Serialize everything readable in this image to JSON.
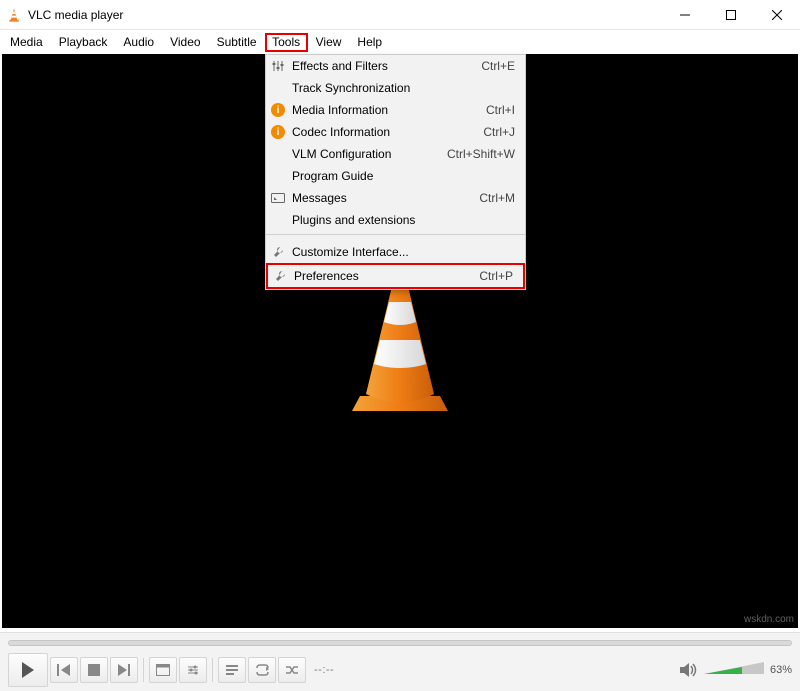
{
  "window": {
    "title": "VLC media player"
  },
  "menubar": {
    "items": [
      "Media",
      "Playback",
      "Audio",
      "Video",
      "Subtitle",
      "Tools",
      "View",
      "Help"
    ],
    "selectedIndex": 5
  },
  "toolsMenu": {
    "items": [
      {
        "icon": "sliders",
        "label": "Effects and Filters",
        "shortcut": "Ctrl+E"
      },
      {
        "icon": "",
        "label": "Track Synchronization",
        "shortcut": ""
      },
      {
        "icon": "info",
        "label": "Media Information",
        "shortcut": "Ctrl+I"
      },
      {
        "icon": "info",
        "label": "Codec Information",
        "shortcut": "Ctrl+J"
      },
      {
        "icon": "",
        "label": "VLM Configuration",
        "shortcut": "Ctrl+Shift+W"
      },
      {
        "icon": "",
        "label": "Program Guide",
        "shortcut": ""
      },
      {
        "icon": "messages",
        "label": "Messages",
        "shortcut": "Ctrl+M"
      },
      {
        "icon": "",
        "label": "Plugins and extensions",
        "shortcut": ""
      },
      {
        "sep": true
      },
      {
        "icon": "wrench",
        "label": "Customize Interface...",
        "shortcut": ""
      },
      {
        "icon": "wrench",
        "label": "Preferences",
        "shortcut": "Ctrl+P",
        "highlight": true
      }
    ]
  },
  "time": {
    "current": "--:--",
    "total": "--:--"
  },
  "volume": {
    "percent": "63%"
  },
  "watermark": "wskdn.com"
}
